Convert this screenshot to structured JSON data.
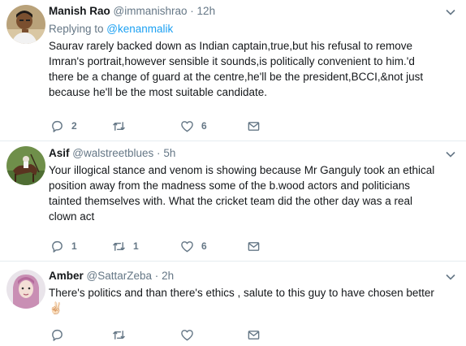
{
  "tweets": [
    {
      "name": "Manish Rao",
      "handle": "@immanishrao",
      "dot": "·",
      "time": "12h",
      "replying_prefix": "Replying to ",
      "replying_to": "@kenanmalik",
      "text_lines": [
        "Saurav rarely backed down as Indian captain,true,but his refusal to remove",
        "Imran's portrait,however sensible it sounds,is politically convenient to him.'d",
        "there be a change of guard at the centre,he'll be the president,BCCI,&not just",
        "because he'll be the most suitable candidate."
      ],
      "reply_count": "2",
      "retweet_count": "",
      "like_count": "6"
    },
    {
      "name": "Asif",
      "handle": "@walstreetblues",
      "dot": "·",
      "time": "5h",
      "text_lines": [
        "Your illogical stance and venom is showing because Mr Ganguly took an ethical",
        "position away from the madness some of the b.wood actors and politicians",
        "tainted themselves with.  What the cricket team did the other day was a real",
        "clown act"
      ],
      "reply_count": "1",
      "retweet_count": "1",
      "like_count": "6"
    },
    {
      "name": "Amber",
      "handle": "@SattarZeba",
      "dot": "·",
      "time": "2h",
      "text_lines": [
        "There's politics and than there's ethics , salute to this guy to have chosen better"
      ],
      "emoji": "✌🏻",
      "reply_count": "",
      "retweet_count": "",
      "like_count": ""
    }
  ],
  "icons": {
    "reply": "reply-icon",
    "retweet": "retweet-icon",
    "like": "heart-icon",
    "dm": "envelope-icon",
    "caret": "chevron-down-icon"
  },
  "colors": {
    "link": "#1da1f2",
    "secondary": "#657786",
    "divider": "#e6ecf0"
  }
}
